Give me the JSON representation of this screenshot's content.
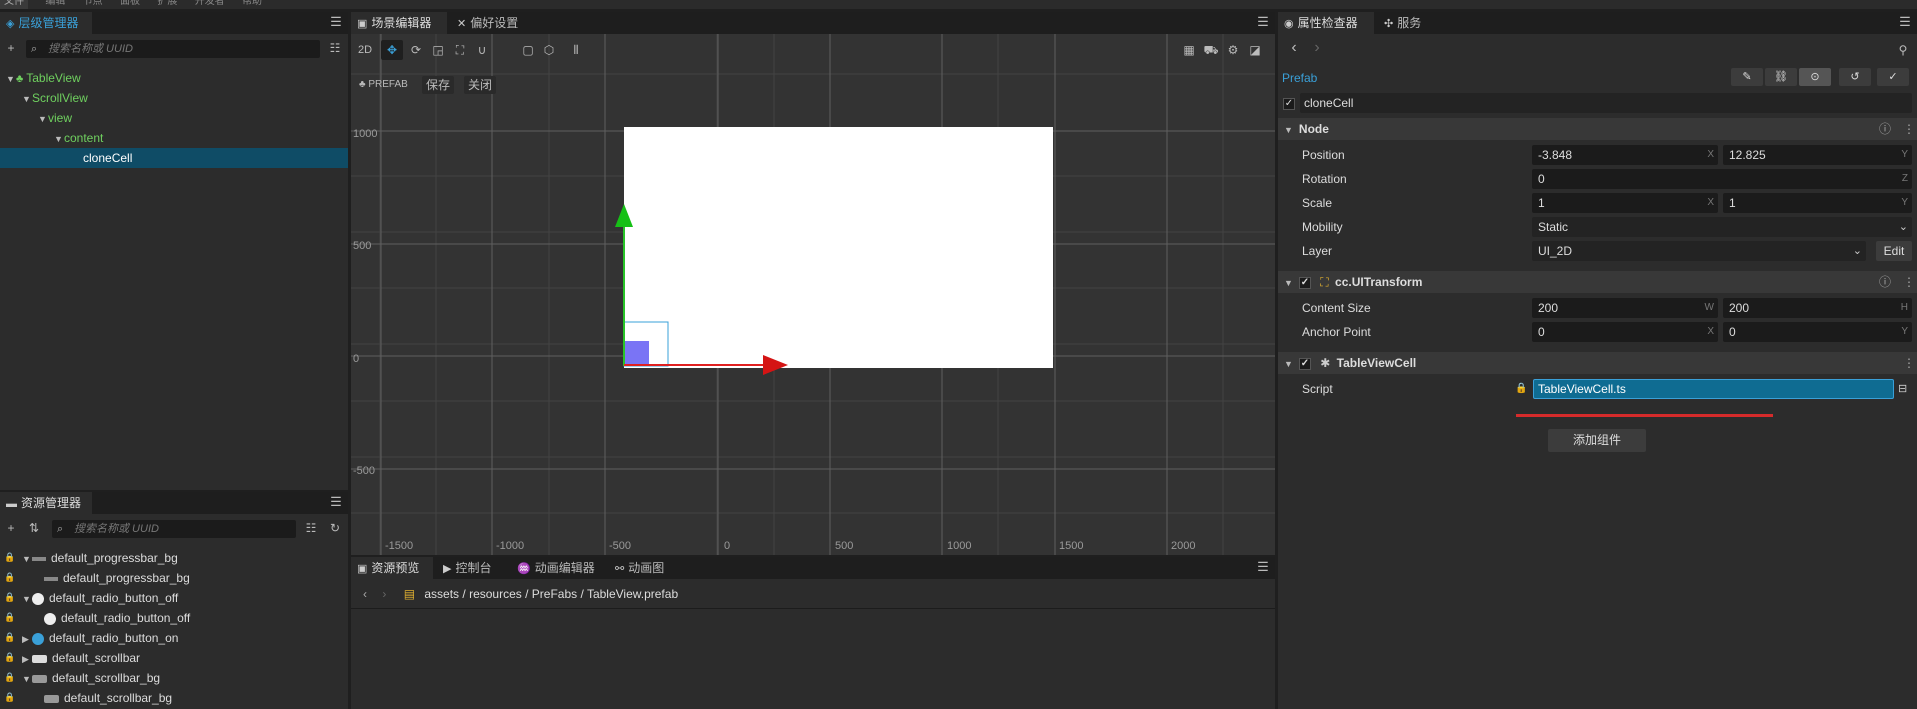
{
  "menubar": [
    "文件",
    "编辑",
    "节点",
    "面板",
    "扩展",
    "开发者",
    "帮助"
  ],
  "hierarchy": {
    "tab": "层级管理器",
    "search_placeholder": "搜索名称或 UUID",
    "nodes": [
      "TableView",
      "ScrollView",
      "view",
      "content",
      "cloneCell"
    ]
  },
  "assets": {
    "tab": "资源管理器",
    "search_placeholder": "搜索名称或 UUID",
    "items": [
      "default_progressbar_bg",
      "default_progressbar_bg",
      "default_radio_button_off",
      "default_radio_button_off",
      "default_radio_button_on",
      "default_scrollbar",
      "default_scrollbar_bg",
      "default_scrollbar_bg"
    ]
  },
  "scene": {
    "tabs": [
      "场景编辑器",
      "偏好设置"
    ],
    "mode_2d": "2D",
    "prefab_label": "PREFAB",
    "save": "保存",
    "close": "关闭",
    "y_labels": [
      "1000",
      "500",
      "0",
      "-500"
    ],
    "x_labels": [
      "-1500",
      "-1000",
      "-500",
      "0",
      "500",
      "1000",
      "1500",
      "2000"
    ]
  },
  "bottom": {
    "tabs": [
      "资源预览",
      "控制台",
      "动画编辑器",
      "动画图"
    ],
    "path": [
      "assets",
      "resources",
      "PreFabs",
      "TableView.prefab"
    ]
  },
  "inspector": {
    "tabs": [
      "属性检查器",
      "服务"
    ],
    "prefab_label": "Prefab",
    "node_name": "cloneCell",
    "node_section": "Node",
    "position_label": "Position",
    "position": [
      "-3.848",
      "12.825"
    ],
    "rotation_label": "Rotation",
    "rotation": "0",
    "scale_label": "Scale",
    "scale": [
      "1",
      "1"
    ],
    "mobility_label": "Mobility",
    "mobility": "Static",
    "layer_label": "Layer",
    "layer": "UI_2D",
    "edit": "Edit",
    "uitransform": "cc.UITransform",
    "content_size_label": "Content Size",
    "content_size": [
      "200",
      "200"
    ],
    "anchor_label": "Anchor Point",
    "anchor": [
      "0",
      "0"
    ],
    "tableviewcell": "TableViewCell",
    "script_label": "Script",
    "script": "TableViewCell.ts",
    "add_component": "添加组件",
    "axes": [
      "X",
      "Y",
      "Z",
      "W",
      "H"
    ]
  },
  "colors": {
    "accent": "#3aa0d8",
    "green": "#6fd05f",
    "red_underline": "#d62b2b"
  }
}
